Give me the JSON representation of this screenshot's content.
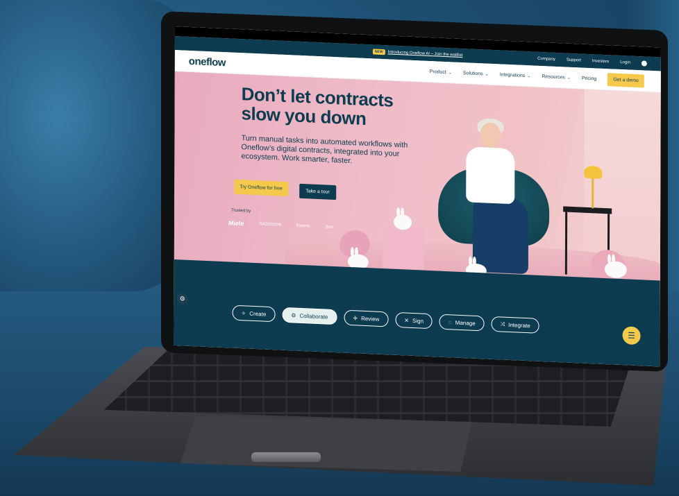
{
  "announcement": {
    "badge": "NEW",
    "text": "Introducing Oneflow AI – Join the waitlist"
  },
  "utility_nav": [
    "Company",
    "Support",
    "Investors",
    "Login"
  ],
  "brand": {
    "logo": "oneflow",
    "accent": "#f5c94b",
    "primary": "#0d3b4f"
  },
  "main_nav": {
    "items": [
      {
        "label": "Product",
        "has_dropdown": true
      },
      {
        "label": "Solutions",
        "has_dropdown": true
      },
      {
        "label": "Integrations",
        "has_dropdown": true
      },
      {
        "label": "Resources",
        "has_dropdown": true
      },
      {
        "label": "Pricing",
        "has_dropdown": false
      }
    ],
    "cta": "Get a demo"
  },
  "hero": {
    "title": "Don’t let contracts slow you down",
    "subtitle": "Turn manual tasks into automated workflows with Oneflow’s digital contracts, integrated into your ecosystem. Work smarter, faster.",
    "primary_button": "Try Oneflow for free",
    "secondary_button": "Take a tour",
    "trusted_label": "Trusted by",
    "logos": [
      "Miele",
      "RADISSON",
      "Experis",
      "dors"
    ]
  },
  "feature_tabs": [
    {
      "label": "Create",
      "icon": "sparkle-icon",
      "active": false
    },
    {
      "label": "Collaborate",
      "icon": "gear-icon",
      "active": true
    },
    {
      "label": "Review",
      "icon": "plus-icon",
      "active": false
    },
    {
      "label": "Sign",
      "icon": "x-icon",
      "active": false
    },
    {
      "label": "Manage",
      "icon": "spinner-icon",
      "active": false
    },
    {
      "label": "Integrate",
      "icon": "arrows-icon",
      "active": false
    }
  ],
  "icons": {
    "settings": "⚙",
    "chat": "☰",
    "chevron": "⌄",
    "tab_glyphs": [
      "✧",
      "⚙",
      "✛",
      "✕",
      "◌",
      "⤨"
    ]
  }
}
